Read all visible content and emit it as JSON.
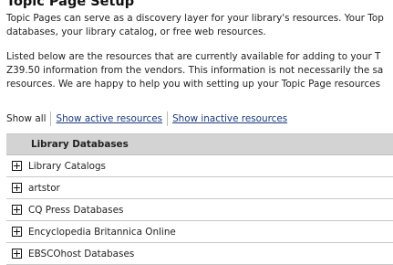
{
  "page": {
    "title": "Topic Page Setup",
    "intro_line1": "Topic Pages can serve as a discovery layer for your library's resources. Your Top",
    "intro_line2": "databases, your library catalog, or free web resources.",
    "listed_line1": "Listed below are the resources that are currently available for adding to your T",
    "listed_line2": "Z39.50 information from the vendors. This information is not necessarily the sa",
    "listed_line3": "resources. We are happy to help you with setting up your Topic Page resources"
  },
  "filter": {
    "show_all": "Show all",
    "show_active": "Show active resources",
    "show_inactive": "Show inactive resources"
  },
  "table": {
    "header": "Library Databases",
    "rows": [
      "Library Catalogs",
      "artstor",
      "CQ Press Databases",
      "Encyclopedia Britannica Online",
      "EBSCOhost Databases"
    ]
  }
}
